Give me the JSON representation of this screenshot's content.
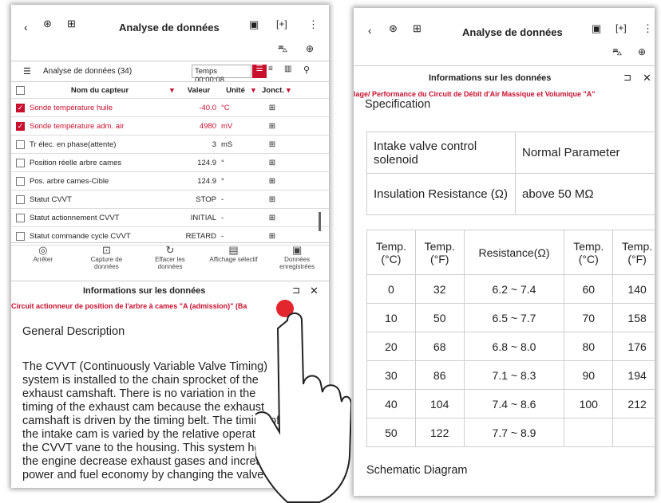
{
  "left": {
    "title": "Analyse de données",
    "list_title": "Analyse de données (34)",
    "time": "Temps 00:00:08",
    "columns": [
      "Nom du capteur",
      "Valeur",
      "Unité",
      "Jonct."
    ],
    "rows": [
      {
        "name": "Sonde température huile",
        "value": "-40.0",
        "unit": "°C",
        "checked": true
      },
      {
        "name": "Sonde température adm. air",
        "value": "4980",
        "unit": "mV",
        "checked": true
      },
      {
        "name": "Tr élec. en phase(attente)",
        "value": "3",
        "unit": "mS",
        "checked": false
      },
      {
        "name": "Position réelle arbre cames",
        "value": "124.9",
        "unit": "°",
        "checked": false
      },
      {
        "name": "Pos. arbre cames-Cible",
        "value": "124.9",
        "unit": "°",
        "checked": false
      },
      {
        "name": "Statut CVVT",
        "value": "STOP",
        "unit": "-",
        "checked": false
      },
      {
        "name": "Statut actionnement CVVT",
        "value": "INITIAL",
        "unit": "-",
        "checked": false
      },
      {
        "name": "Statut commande cycle CVVT",
        "value": "RETARD",
        "unit": "-",
        "checked": false
      }
    ],
    "toolbar": [
      {
        "icon": "stop-icon",
        "label": "Arrêter"
      },
      {
        "icon": "capture-icon",
        "label": "Capture de données"
      },
      {
        "icon": "refresh-icon",
        "label": "Effacer les données"
      },
      {
        "icon": "selective-display-icon",
        "label": "Affichage sélectif"
      },
      {
        "icon": "saved-data-icon",
        "label": "Données enregistrées"
      }
    ],
    "info_title": "Informations sur les données",
    "info_subtitle": "Circuit actionneur de position de l'arbre à cames \"A (admission)\" (Ba",
    "section": "General Description",
    "body": "The CVVT (Continuously Variable Valve Timing) system is installed to the chain sprocket of the exhaust camshaft. There is no variation in the timing of the exhaust cam because the exhaust camshaft is driven by the timing belt. The timing of the intake cam is varied by the relative operation of the CVVT vane to the housing. This system helps the engine decrease exhaust gases and increase power and fuel economy by changing the valve"
  },
  "right": {
    "title": "Analyse de données",
    "info_title": "Informations sur les données",
    "info_subtitle": "lage/ Performance du Circuit de Débit d'Air Massique et Volumique \"A\"",
    "section": "Specification",
    "spec_rows": [
      {
        "k": "Intake valve control solenoid",
        "v": "Normal Parameter"
      },
      {
        "k": "Insulation Resistance (Ω)",
        "v": "above 50 MΩ"
      }
    ],
    "temp_headers": [
      "Temp. (°C)",
      "Temp. (°F)",
      "Resistance(Ω)",
      "Temp. (°C)",
      "Temp. (°F)"
    ],
    "temp_rows": [
      [
        "0",
        "32",
        "6.2 ~ 7.4",
        "60",
        "140"
      ],
      [
        "10",
        "50",
        "6.5 ~ 7.7",
        "70",
        "158"
      ],
      [
        "20",
        "68",
        "6.8 ~ 8.0",
        "80",
        "176"
      ],
      [
        "30",
        "86",
        "7.1 ~ 8.3",
        "90",
        "194"
      ],
      [
        "40",
        "104",
        "7.4 ~ 8.6",
        "100",
        "212"
      ],
      [
        "50",
        "122",
        "7.7 ~ 8.9",
        "",
        ""
      ]
    ],
    "section2": "Schematic Diagram"
  }
}
